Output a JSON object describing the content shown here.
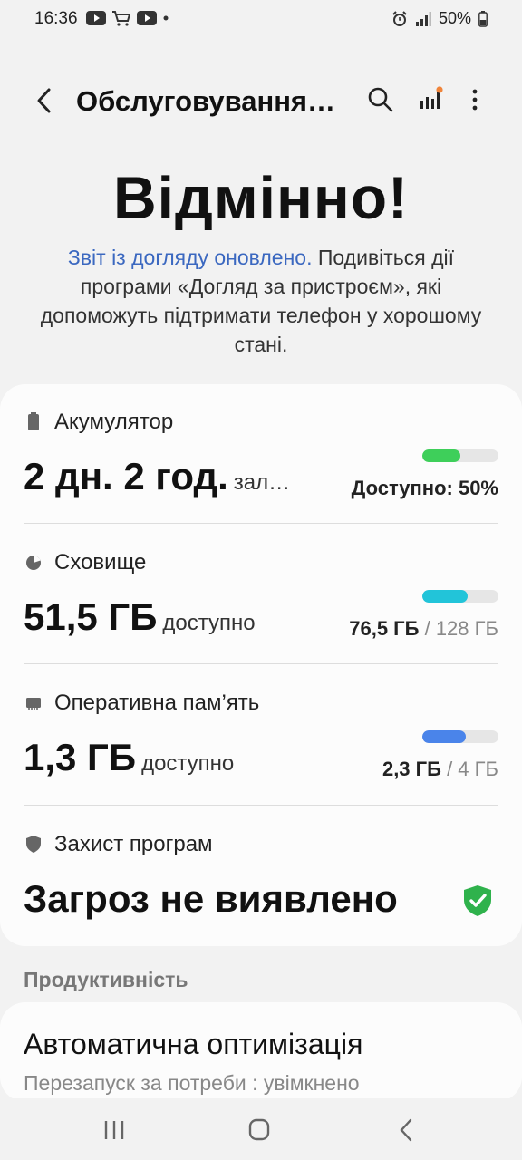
{
  "status": {
    "time": "16:36",
    "battery": "50%"
  },
  "appbar": {
    "title": "Обслуговування…"
  },
  "hero": {
    "title": "Відмінно!",
    "link_text": "Звіт із догляду оновлено.",
    "desc_text": " Подивіться дії програми «Догляд за пристроєм», які допоможуть підтримати телефон у хорошому стані."
  },
  "battery": {
    "label": "Акумулятор",
    "value": "2 дн. 2 год.",
    "suffix": "зал…",
    "status": "Доступно: 50%",
    "level": 0.5,
    "color": "#3ecf5a"
  },
  "storage": {
    "label": "Сховище",
    "value": "51,5 ГБ",
    "suffix": "доступно",
    "used": "76,5 ГБ",
    "total": "/ 128 ГБ",
    "level": 0.6,
    "color": "#22c4d9"
  },
  "ram": {
    "label": "Оперативна пам’ять",
    "value": "1,3 ГБ",
    "suffix": "доступно",
    "used": "2,3 ГБ",
    "total": "/ 4 ГБ",
    "level": 0.57,
    "color": "#4a84ea"
  },
  "protection": {
    "label": "Захист програм",
    "value": "Загроз не виявлено",
    "color": "#2fb24c"
  },
  "productivity": {
    "header": "Продуктивність",
    "item_title": "Автоматична оптимізація",
    "item_sub": "Перезапуск за потреби : увімкнено"
  }
}
